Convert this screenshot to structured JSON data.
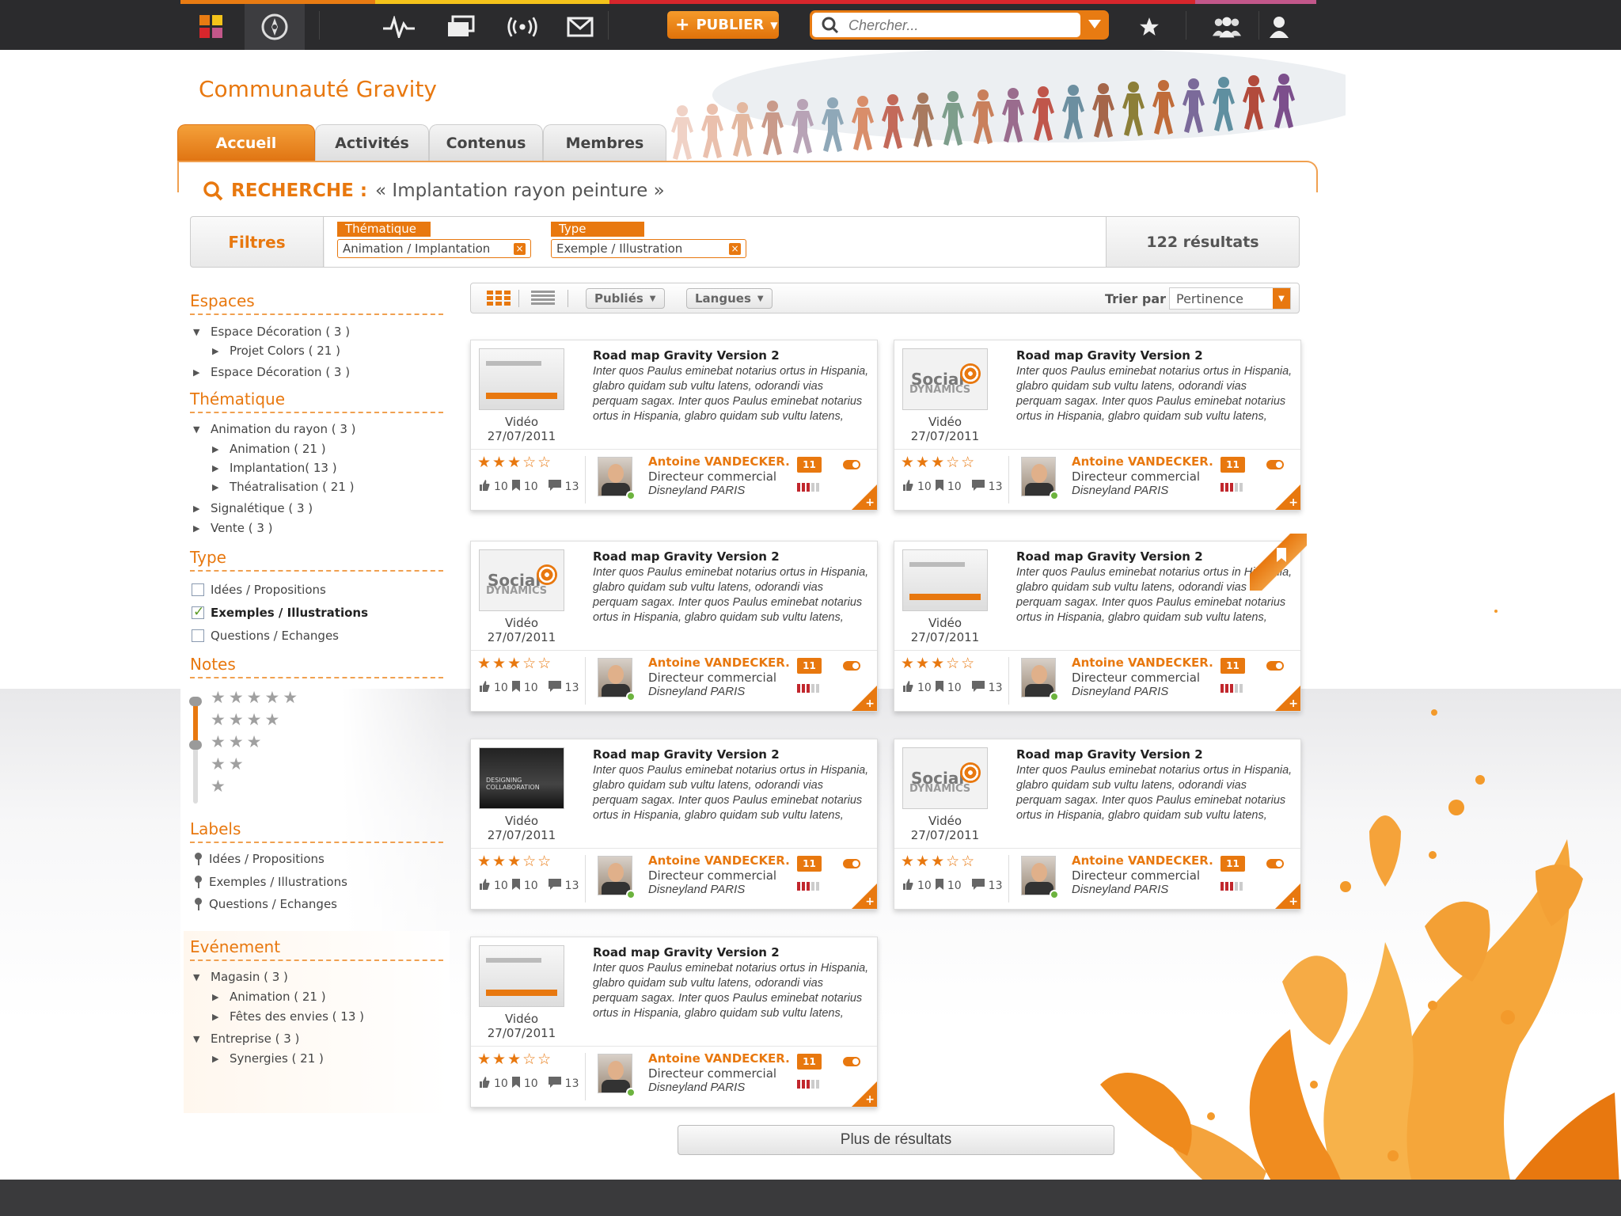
{
  "topbar": {
    "publish_label": "PUBLIER",
    "search_placeholder": "Chercher...",
    "icons": [
      "apps-grid-icon",
      "compass-icon",
      "activity-icon",
      "cards-icon",
      "broadcast-icon",
      "mail-icon",
      "star-icon",
      "group-icon",
      "user-icon"
    ]
  },
  "page": {
    "title": "Communauté Gravity",
    "tabs": [
      "Accueil",
      "Activités",
      "Contenus",
      "Membres"
    ]
  },
  "search": {
    "label": "RECHERCHE :",
    "query": "« Implantation rayon peinture »"
  },
  "filters": {
    "label": "Filtres",
    "chips": [
      {
        "category": "Thématique",
        "value": "Animation / Implantation"
      },
      {
        "category": "Type",
        "value": "Exemple / Illustration"
      }
    ],
    "results": "122 résultats"
  },
  "sidebar": {
    "espaces": {
      "title": "Espaces",
      "items": [
        {
          "label": "Espace Décoration ( 3 )",
          "open": true
        },
        {
          "label": "Projet Colors ( 21 )"
        },
        {
          "label": "Espace Décoration ( 3 )"
        }
      ]
    },
    "thematique": {
      "title": "Thématique",
      "items": [
        {
          "label": "Animation du rayon ( 3 )"
        },
        {
          "label": "Animation ( 21 )"
        },
        {
          "label": "Implantation( 13 )"
        },
        {
          "label": "Théatralisation ( 21 )"
        },
        {
          "label": "Signalétique ( 3 )"
        },
        {
          "label": "Vente ( 3 )"
        }
      ]
    },
    "type": {
      "title": "Type",
      "items": [
        {
          "label": "Idées / Propositions",
          "checked": false
        },
        {
          "label": "Exemples / Illustrations",
          "checked": true
        },
        {
          "label": "Questions / Echanges",
          "checked": false
        }
      ]
    },
    "notes": {
      "title": "Notes",
      "levels": [
        5,
        4,
        3,
        2,
        1
      ]
    },
    "labels": {
      "title": "Labels",
      "items": [
        "Idées / Propositions",
        "Exemples / Illustrations",
        "Questions / Echanges"
      ]
    },
    "evenement": {
      "title": "Evénement",
      "items": [
        {
          "label": "Magasin ( 3 )"
        },
        {
          "label": "Animation ( 21 )"
        },
        {
          "label": "Fêtes des envies ( 13 )"
        },
        {
          "label": "Entreprise ( 3 )"
        },
        {
          "label": "Synergies ( 21 )"
        }
      ]
    }
  },
  "toolbar": {
    "published_label": "Publiés",
    "languages_label": "Langues",
    "sort_label": "Trier par",
    "sort_value": "Pertinence"
  },
  "results": [
    {
      "thumb": "screen",
      "type": "Vidéo",
      "date": "27/07/2011",
      "title": "Road map Gravity Version 2",
      "description": "Inter quos Paulus eminebat notarius ortus in Hispania, glabro quidam sub vultu latens, odorandi vias perquam sagax. Inter quos Paulus eminebat notarius ortus in Hispania, glabro quidam sub vultu latens,",
      "rating": 3,
      "likes": "10",
      "bookmarks": "10",
      "comments": "13",
      "author": "Antoine VANDECKER.",
      "role": "Directeur commercial",
      "company": "Disneyland PARIS",
      "badge": "11"
    },
    {
      "thumb": "social",
      "type": "Vidéo",
      "date": "27/07/2011",
      "title": "Road map Gravity Version 2",
      "description": "Inter quos Paulus eminebat notarius ortus in Hispania, glabro quidam sub vultu latens, odorandi vias perquam sagax. Inter quos Paulus eminebat notarius ortus in Hispania, glabro quidam sub vultu latens,",
      "rating": 3,
      "likes": "10",
      "bookmarks": "10",
      "comments": "13",
      "author": "Antoine VANDECKER.",
      "role": "Directeur commercial",
      "company": "Disneyland PARIS",
      "badge": "11"
    },
    {
      "thumb": "social",
      "type": "Vidéo",
      "date": "27/07/2011",
      "title": "Road map Gravity Version 2",
      "description": "Inter quos Paulus eminebat notarius ortus in Hispania, glabro quidam sub vultu latens, odorandi vias perquam sagax. Inter quos Paulus eminebat notarius ortus in Hispania, glabro quidam sub vultu latens,",
      "rating": 3,
      "likes": "10",
      "bookmarks": "10",
      "comments": "13",
      "author": "Antoine VANDECKER.",
      "role": "Directeur commercial",
      "company": "Disneyland PARIS",
      "badge": "11"
    },
    {
      "thumb": "screen",
      "type": "Vidéo",
      "date": "27/07/2011",
      "title": "Road map Gravity Version 2",
      "description": "Inter quos Paulus eminebat notarius ortus in Hispania, glabro quidam sub vultu latens, odorandi vias perquam sagax. Inter quos Paulus eminebat notarius ortus in Hispania, glabro quidam sub vultu latens,",
      "rating": 3,
      "likes": "10",
      "bookmarks": "10",
      "comments": "13",
      "author": "Antoine VANDECKER.",
      "role": "Directeur commercial",
      "company": "Disneyland PARIS",
      "badge": "11",
      "bookmarked": true
    },
    {
      "thumb": "dark",
      "thumb_text": "DESIGNING COLLABORATION",
      "type": "Vidéo",
      "date": "27/07/2011",
      "title": "Road map Gravity Version 2",
      "description": "Inter quos Paulus eminebat notarius ortus in Hispania, glabro quidam sub vultu latens, odorandi vias perquam sagax. Inter quos Paulus eminebat notarius ortus in Hispania, glabro quidam sub vultu latens,",
      "rating": 3,
      "likes": "10",
      "bookmarks": "10",
      "comments": "13",
      "author": "Antoine VANDECKER.",
      "role": "Directeur commercial",
      "company": "Disneyland PARIS",
      "badge": "11"
    },
    {
      "thumb": "social",
      "type": "Vidéo",
      "date": "27/07/2011",
      "title": "Road map Gravity Version 2",
      "description": "Inter quos Paulus eminebat notarius ortus in Hispania, glabro quidam sub vultu latens, odorandi vias perquam sagax. Inter quos Paulus eminebat notarius ortus in Hispania, glabro quidam sub vultu latens,",
      "rating": 3,
      "likes": "10",
      "bookmarks": "10",
      "comments": "13",
      "author": "Antoine VANDECKER.",
      "role": "Directeur commercial",
      "company": "Disneyland PARIS",
      "badge": "11"
    },
    {
      "thumb": "screen",
      "type": "Vidéo",
      "date": "27/07/2011",
      "title": "Road map Gravity Version 2",
      "description": "Inter quos Paulus eminebat notarius ortus in Hispania, glabro quidam sub vultu latens, odorandi vias perquam sagax. Inter quos Paulus eminebat notarius ortus in Hispania, glabro quidam sub vultu latens,",
      "rating": 3,
      "likes": "10",
      "bookmarks": "10",
      "comments": "13",
      "author": "Antoine VANDECKER.",
      "role": "Directeur commercial",
      "company": "Disneyland PARIS",
      "badge": "11"
    }
  ],
  "more_label": "Plus de résultats",
  "colors": {
    "accent": "#e8780f",
    "topbar": "#2b2b2d",
    "online": "#6cb33e",
    "meter": "#c1272d"
  }
}
